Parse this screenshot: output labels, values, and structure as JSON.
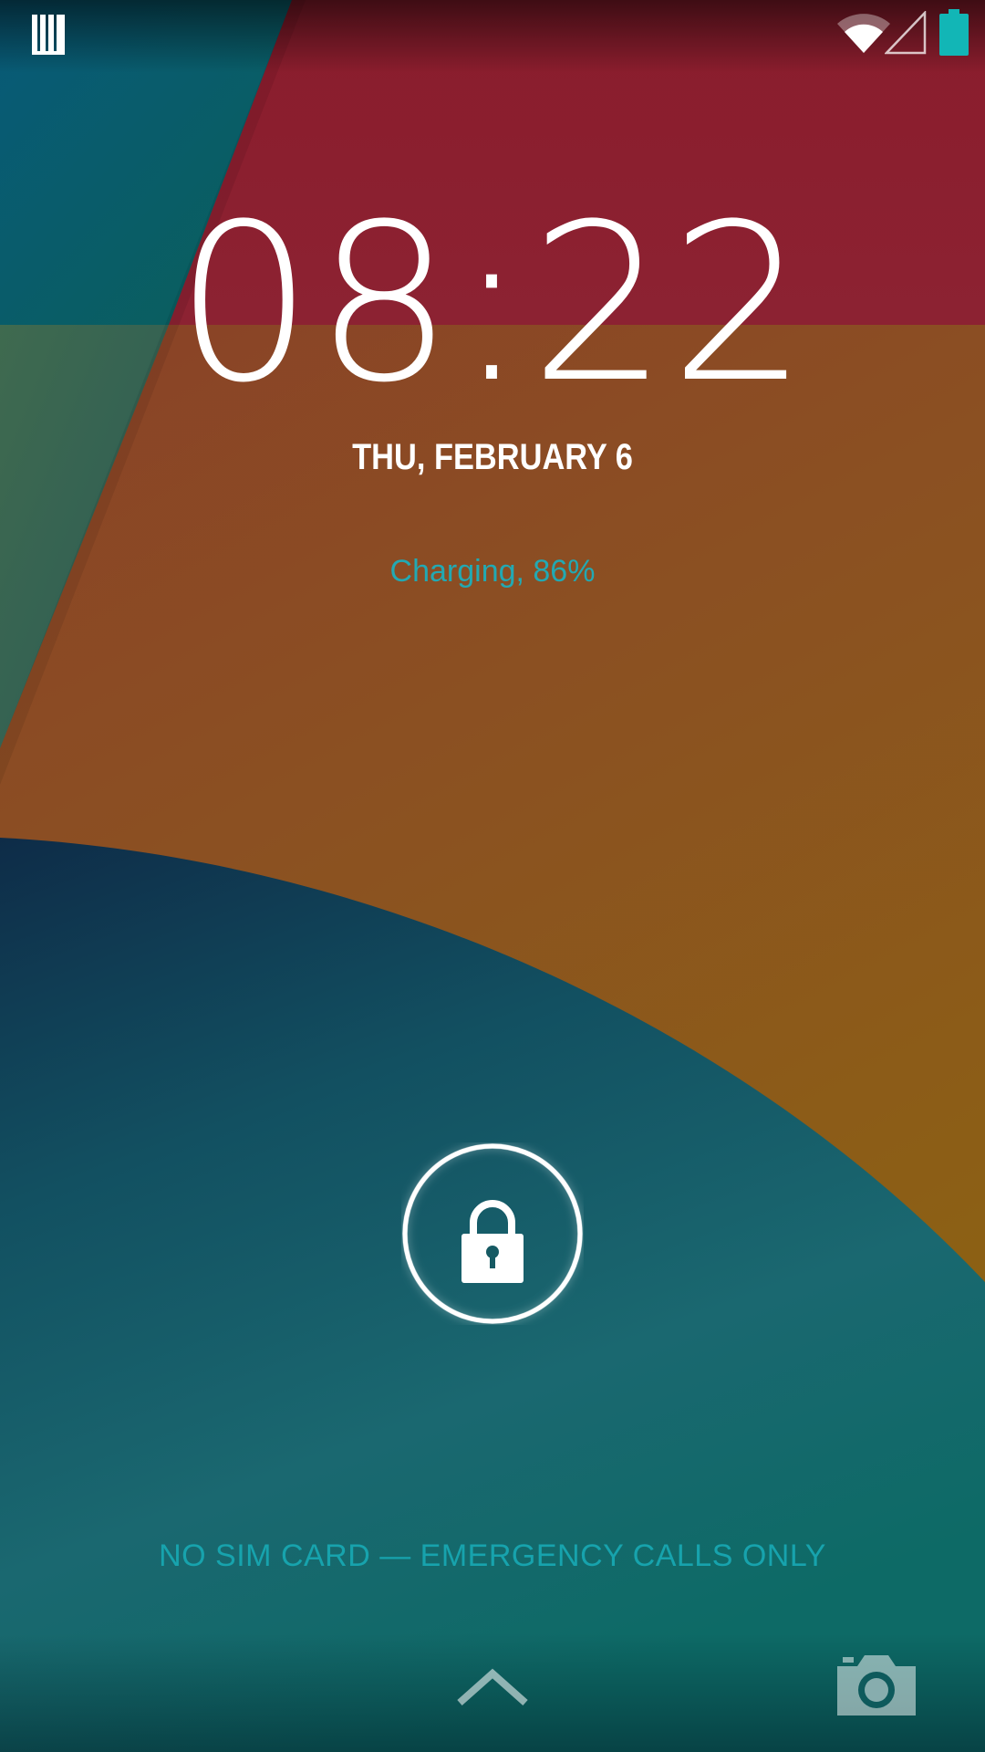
{
  "status_bar": {
    "left_icon": "notification-cards-icon",
    "wifi_icon": "wifi-icon",
    "signal_icon": "cell-signal-icon",
    "battery_icon": "battery-icon",
    "battery_color": "#12b6b6"
  },
  "lockscreen": {
    "time": "08:22",
    "date": "THU, FEBRUARY 6",
    "charging_status": "Charging, 86%",
    "charging_color": "#22a9b3",
    "lock_icon": "lock-icon",
    "carrier_text": "NO SIM CARD — EMERGENCY CALLS ONLY",
    "up_arrow_icon": "chevron-up-icon",
    "camera_icon": "camera-icon"
  },
  "colors": {
    "red": "#8c202f",
    "orange": "#8b4a22",
    "teal": "#0e5a5c",
    "blue": "#0b4f6a"
  }
}
